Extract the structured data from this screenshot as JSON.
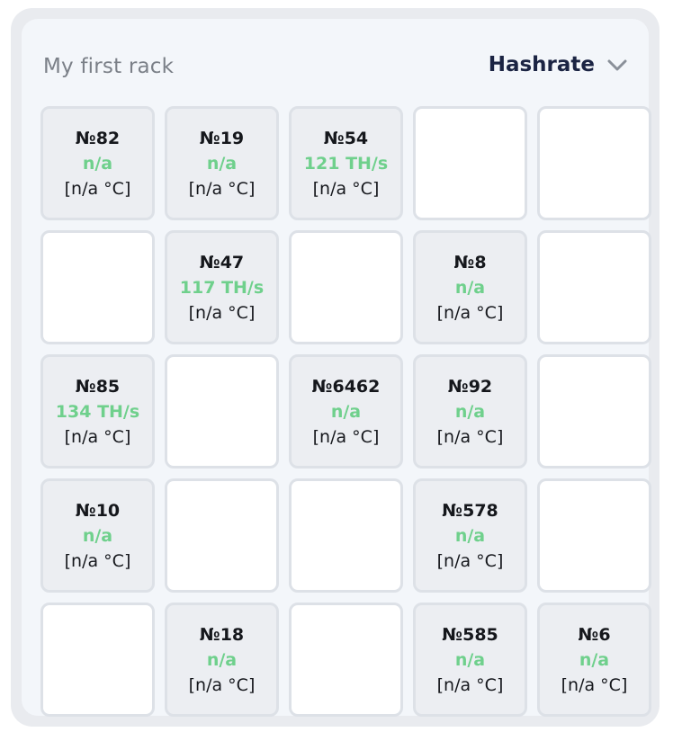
{
  "rack": {
    "title": "My first rack",
    "metric": "Hashrate",
    "metric_icon": "chevron-down-icon",
    "colors": {
      "hashrate": "#6fd08c",
      "title": "#7b8088",
      "metric": "#1b2443"
    }
  },
  "cells": [
    {
      "name": "№82",
      "hashrate": "n/a",
      "temp": "[n/a °C]"
    },
    {
      "name": "№19",
      "hashrate": "n/a",
      "temp": "[n/a °C]"
    },
    {
      "name": "№54",
      "hashrate": "121 TH/s",
      "temp": "[n/a °C]"
    },
    null,
    null,
    null,
    {
      "name": "№47",
      "hashrate": "117 TH/s",
      "temp": "[n/a °C]"
    },
    null,
    {
      "name": "№8",
      "hashrate": "n/a",
      "temp": "[n/a °C]"
    },
    null,
    {
      "name": "№85",
      "hashrate": "134 TH/s",
      "temp": "[n/a °C]"
    },
    null,
    {
      "name": "№6462",
      "hashrate": "n/a",
      "temp": "[n/a °C]"
    },
    {
      "name": "№92",
      "hashrate": "n/a",
      "temp": "[n/a °C]"
    },
    null,
    {
      "name": "№10",
      "hashrate": "n/a",
      "temp": "[n/a °C]"
    },
    null,
    null,
    {
      "name": "№578",
      "hashrate": "n/a",
      "temp": "[n/a °C]"
    },
    null,
    null,
    {
      "name": "№18",
      "hashrate": "n/a",
      "temp": "[n/a °C]"
    },
    null,
    {
      "name": "№585",
      "hashrate": "n/a",
      "temp": "[n/a °C]"
    },
    {
      "name": "№6",
      "hashrate": "n/a",
      "temp": "[n/a °C]"
    }
  ]
}
